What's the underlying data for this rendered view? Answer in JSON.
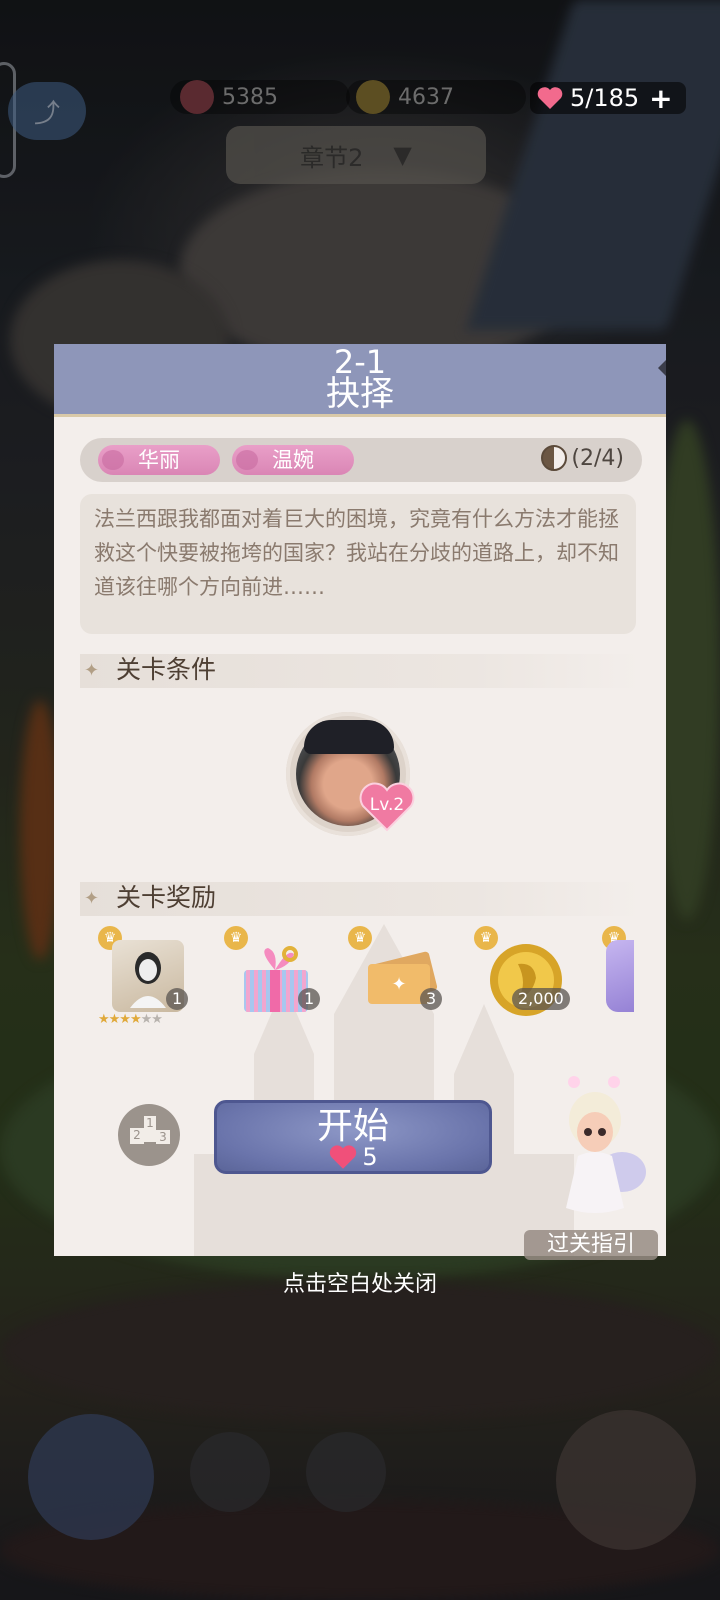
{
  "top_bar": {
    "hearts_value": "5385",
    "coins_value": "4637",
    "energy": "5/185",
    "energy_plus": "+",
    "chapter_label": "章节2"
  },
  "stage": {
    "number": "2-1",
    "title": "抉择",
    "tags": [
      "华丽",
      "温婉"
    ],
    "progress": "(2/4)",
    "progress_fraction": 0.5,
    "story": "法兰西跟我都面对着巨大的困境，究竟有什么方法才能拯救这个快要被拖垮的国家？我站在分歧的道路上，却不知道该往哪个方向前进……"
  },
  "conditions": {
    "title": "关卡条件",
    "character_level": "Lv.2"
  },
  "rewards": {
    "title": "关卡奖励",
    "items": [
      {
        "icon": "bust-portrait-icon",
        "qty": "1",
        "stars_on": 4,
        "stars_total": 6
      },
      {
        "icon": "gift-box-icon",
        "qty": "1"
      },
      {
        "icon": "ticket-icon",
        "qty": "3"
      },
      {
        "icon": "gold-coin-icon",
        "qty": "2,000"
      },
      {
        "icon": "purple-item-icon",
        "qty": ""
      }
    ]
  },
  "actions": {
    "start_label": "开始",
    "start_cost": "5",
    "podium_labels": [
      "1",
      "2",
      "3"
    ],
    "guide_label": "过关指引",
    "close_hint": "点击空白处关闭"
  },
  "colors": {
    "header": "#8e96b9",
    "panel": "#f3eeeb",
    "tag_pink": "#e39ac4",
    "heart": "#f0507a",
    "start_button": "#6f79ae"
  }
}
